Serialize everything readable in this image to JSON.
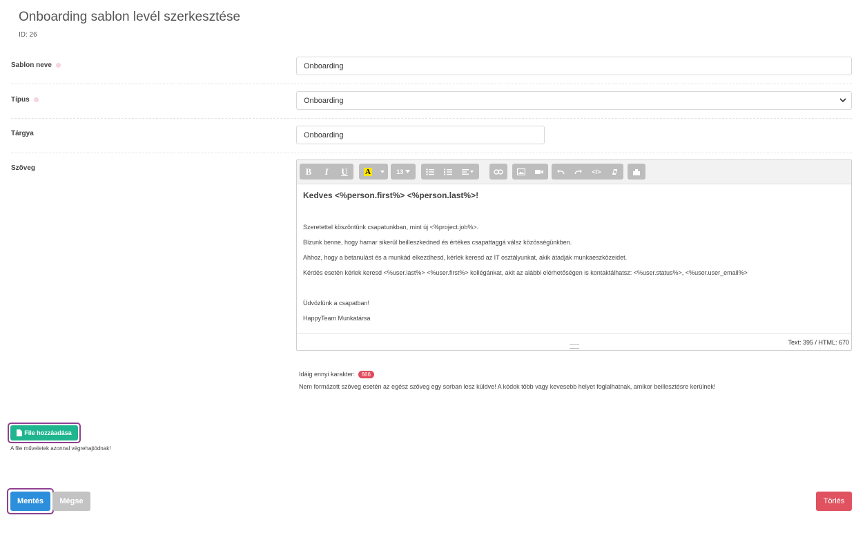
{
  "header": {
    "title": "Onboarding sablon levél szerkesztése",
    "id_label": "ID: 26"
  },
  "form": {
    "template_name": {
      "label": "Sablon neve",
      "value": "Onboarding"
    },
    "type": {
      "label": "Típus",
      "value": "Onboarding"
    },
    "subject": {
      "label": "Tárgya",
      "value": "Onboarding"
    },
    "body": {
      "label": "Szöveg"
    }
  },
  "toolbar": {
    "font_size": "13",
    "icons": [
      "bold-icon",
      "italic-icon",
      "underline-icon",
      "text-color-icon",
      "font-size-dropdown",
      "unordered-list-icon",
      "ordered-list-icon",
      "align-icon",
      "link-icon",
      "image-icon",
      "video-icon",
      "undo-icon",
      "redo-icon",
      "code-view-icon",
      "clear-format-icon",
      "plugin-icon"
    ]
  },
  "editor": {
    "greeting": "Kedves <%person.first%> <%person.last%>!",
    "lines": [
      "Szeretettel köszöntünk csapatunkban, mint új <%project.job%>.",
      "Bízunk benne, hogy hamar sikerül beilleszkedned és értékes csapattaggá válsz közösségünkben.",
      "Ahhoz, hogy a betanulást és a munkád elkezdhesd, kérlek keresd az IT osztályunkat, akik átadják munkaeszközeidet.",
      "Kérdés esetén kérlek keresd <%user.last%> <%user.first%> kollégánkat, akit az alábbi elérhetőségen is kontaktálhatsz: <%user.status%>, <%user.user_email%>"
    ],
    "closing": [
      "Üdvözlünk a csapatban!",
      "HappyTeam Munkatársa"
    ],
    "counter": "Text: 395 / HTML: 670"
  },
  "char_info": {
    "label": "Idáig ennyi karakter:",
    "count": "666",
    "notice": "Nem formázott szöveg esetén az egész szöveg egy sorban lesz küldve! A kódok több vagy kevesebb helyet foglalhatnak, amikor beillesztésre kerülnek!"
  },
  "file": {
    "button_label": "File hozzáadása",
    "note": "A file műveletek azonnal végrehajtódnak!"
  },
  "actions": {
    "save": "Mentés",
    "cancel": "Mégse",
    "delete": "Törlés"
  },
  "colors": {
    "save": "#2d8fdc",
    "file": "#1fb58f",
    "delete": "#e0525f",
    "highlight_ring": "#8e3f91",
    "badge": "#e24a5b"
  }
}
